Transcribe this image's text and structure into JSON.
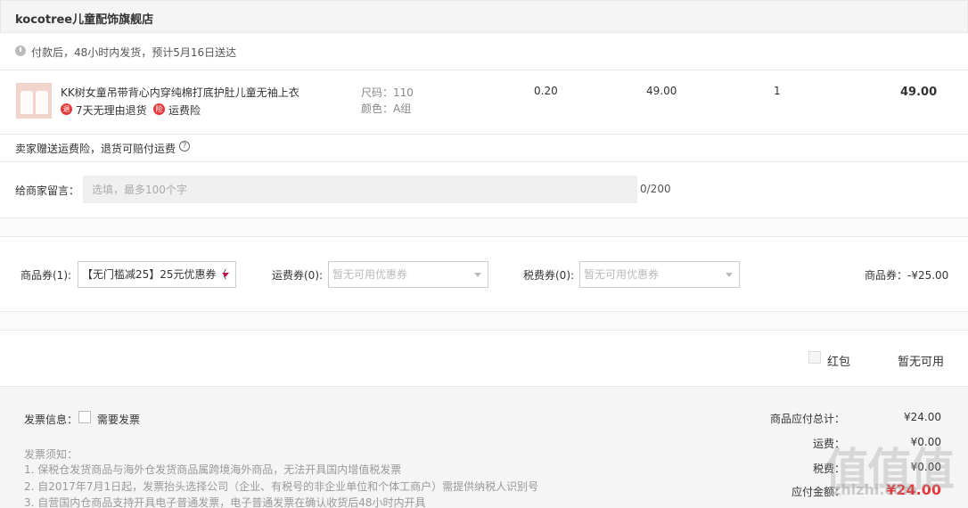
{
  "shop": {
    "name": "kocotree儿童配饰旗舰店"
  },
  "shipping": {
    "note": "付款后，48小时内发货，预计5月16日送达"
  },
  "product": {
    "title": "KK树女童吊带背心内穿纯棉打底护肚儿童无袖上衣",
    "tags": [
      "7天无理由退货",
      "运费险"
    ],
    "tag_icons": [
      "return-icon",
      "insurance-icon"
    ],
    "spec_size": "尺码：110",
    "spec_color": "颜色：A组",
    "col_a": "0.20",
    "unit_price": "49.00",
    "quantity": "1",
    "subtotal": "49.00"
  },
  "insurance": {
    "text": "卖家赠送运费险，退货可赔付运费",
    "help": "?"
  },
  "message": {
    "label": "给商家留言：",
    "placeholder": "选填，最多100个字",
    "count": "0/200"
  },
  "coupons": {
    "goods_label": "商品券(1):",
    "goods_value": "【无门槛减25】25元优惠券（",
    "freight_label": "运费券(0):",
    "freight_value": "暂无可用优惠券",
    "tax_label": "税费券(0):",
    "tax_value": "暂无可用优惠券",
    "total": "商品券：-¥25.00"
  },
  "redpacket": {
    "label": "红包",
    "status": "暂无可用"
  },
  "invoice": {
    "label": "发票信息：",
    "need": "需要发票",
    "notes": [
      "发票须知：",
      "1. 保税仓发货商品与海外仓发货商品属跨境海外商品，无法开具国内增值税发票",
      "2. 自2017年7月1日起，发票抬头选择公司（企业、有税号的非企业单位和个体工商户）需提供纳税人识别号",
      "3. 自营国内仓商品支持开具电子普通发票，电子普通发票在确认收货后48小时内开具"
    ]
  },
  "summary": {
    "goods_label": "商品应付总计：",
    "goods_value": "¥24.00",
    "freight_label": "运费：",
    "freight_value": "¥0.00",
    "tax_label": "税费：",
    "tax_value": "¥0.00",
    "pay_label": "应付金额：",
    "pay_value": "¥24.00"
  },
  "watermark": {
    "brand": "值值值",
    "url": "zhizhi.com"
  },
  "colors": {
    "accent": "#e4393c",
    "bg_gray": "#f5f5f5",
    "border": "#e8e8e8"
  }
}
